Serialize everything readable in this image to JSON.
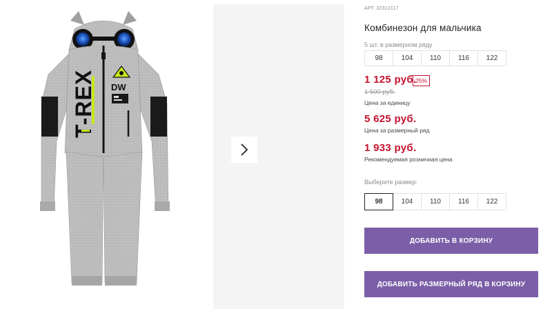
{
  "product": {
    "sku": "АРТ. 32312117",
    "title": "Комбинезон для мальчика",
    "print_text": "T-REX",
    "print_badge": "DW"
  },
  "size_row_note": "5 шт. в размерном ряду",
  "size_row": [
    "98",
    "104",
    "110",
    "116",
    "122"
  ],
  "prices": {
    "unit_price": "1 125 руб.",
    "discount": "25%",
    "old_price": "1 500 руб.",
    "unit_caption": "Цена за единицу",
    "row_price": "5 625 руб.",
    "row_caption": "Цена за размерный ряд",
    "rrp_price": "1 933 руб.",
    "rrp_caption": "Рекомендуемая розничная цена"
  },
  "size_select": {
    "label": "Выберите размер:",
    "options": [
      "98",
      "104",
      "110",
      "116",
      "122"
    ],
    "selected": "98"
  },
  "buttons": {
    "add_to_cart": "ДОБАВИТЬ В КОРЗИНУ",
    "add_row_to_cart": "ДОБАВИТЬ РАЗМЕРНЫЙ РЯД В КОРЗИНУ"
  },
  "colors": {
    "accent_button": "#7b5ea7",
    "price_red": "#c4122f",
    "garment_gray": "#b8b8b8",
    "print_lime": "#c7e81a"
  },
  "icons": {
    "next": "chevron-right-icon"
  }
}
